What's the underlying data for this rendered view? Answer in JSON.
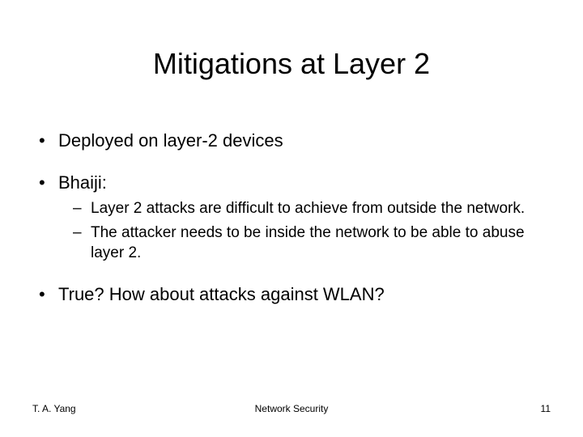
{
  "title": "Mitigations at Layer 2",
  "bullets": [
    {
      "text": "Deployed on layer-2 devices"
    },
    {
      "text": "Bhaiji:",
      "sub": [
        "Layer 2 attacks are difficult to achieve from outside the network.",
        "The attacker needs to be inside the network to be able to abuse layer 2."
      ]
    },
    {
      "text": "True? How about attacks against WLAN?"
    }
  ],
  "footer": {
    "left": "T. A. Yang",
    "center": "Network Security",
    "right": "11"
  }
}
